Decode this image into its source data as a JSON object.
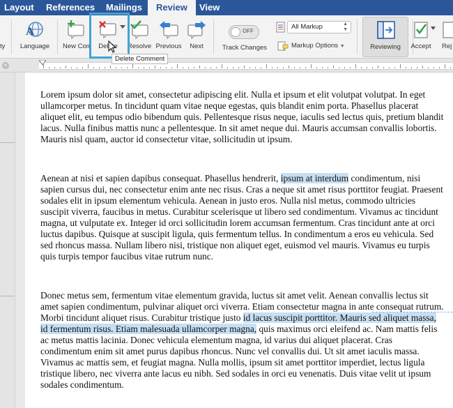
{
  "tabs": [
    "Layout",
    "References",
    "Mailings",
    "Review",
    "View"
  ],
  "active_tab": "Review",
  "ribbon": {
    "left_cut_label": "ty",
    "language_label": "Language",
    "new_comment_label": "New Comment",
    "delete_label": "Delete",
    "resolve_label": "Resolve",
    "previous_label": "Previous",
    "next_label": "Next",
    "track_changes_label": "Track Changes",
    "track_changes_state": "OFF",
    "markup_select_value": "All Markup",
    "markup_options_label": "Markup Options",
    "reviewing_label": "Reviewing",
    "accept_label": "Accept",
    "reject_label": "Rej"
  },
  "tooltip": "Delete Comment",
  "document": {
    "p1": "Lorem ipsum dolor sit amet, consectetur adipiscing elit. Nulla et ipsum et elit volutpat volutpat. In eget ullamcorper metus. In tincidunt quam vitae neque egestas, quis blandit enim porta. Phasellus placerat aliquet elit, eu tempus odio bibendum quis. Pellentesque risus neque, iaculis sed lectus quis, pretium blandit lacus. Nulla finibus mattis nunc a pellentesque. In sit amet neque dui. Mauris accumsan convallis lobortis. Mauris nisl quam, auctor id consectetur vitae, sollicitudin ut ipsum.",
    "p2_before": "Aenean at nisi et sapien dapibus consequat. Phasellus hendrerit, ",
    "p2_selected": "ipsum at interdum",
    "p2_after": " condimentum, nisi sapien cursus dui, nec consectetur enim ante nec risus. Cras a neque sit amet risus porttitor feugiat. Praesent sodales elit in ipsum elementum vehicula. Aenean in justo eros. Nulla nisl metus, commodo ultricies suscipit viverra, faucibus in metus. Curabitur scelerisque ut libero sed condimentum. Vivamus ac tincidunt magna, ut vulputate ex. Integer id orci sollicitudin lorem accumsan fermentum. Cras tincidunt ante at orci luctus dapibus. Quisque at suscipit ligula, quis fermentum tellus. In condimentum a eros eu vehicula. Sed sed rhoncus massa. Nullam libero nisi, tristique non aliquet eget, euismod vel mauris. Vivamus eu turpis quis turpis tempor faucibus vitae rutrum nunc.",
    "p3_before": "Donec metus sem, fermentum vitae elementum gravida, luctus sit amet velit. Aenean convallis lectus sit amet sapien condimentum, pulvinar aliquet orci viverra. Etiam consectetur magna in ante consequat rutrum. Morbi tincidunt aliquet risus. Curabitur tristique justo ",
    "p3_selected": "id lacus suscipit porttitor. Mauris sed aliquet massa, id fermentum risus. Etiam malesuada ullamcorper magna,",
    "p3_after": " quis maximus orci eleifend ac. Nam mattis felis ac metus mattis lacinia. Donec vehicula elementum magna, id varius dui aliquet placerat. Cras condimentum enim sit amet purus dapibus rhoncus. Nunc vel convallis dui. Ut sit amet iaculis massa. Vivamus ac mattis sem, et feugiat magna. Nulla mollis, ipsum sit amet porttitor imperdiet, lectus ligula tristique libero, nec viverra ante lacus eu nibh. Sed sodales in orci eu venenatis. Duis vitae velit ut ipsum sodales condimentum."
  },
  "colors": {
    "tab_bar": "#2b579a",
    "selection": "#c7dff2",
    "highlight_box": "#3fa3d8",
    "delete_x": "#d9312b",
    "resolve_check": "#35a04b",
    "arrow_blue": "#3b7fcf"
  }
}
